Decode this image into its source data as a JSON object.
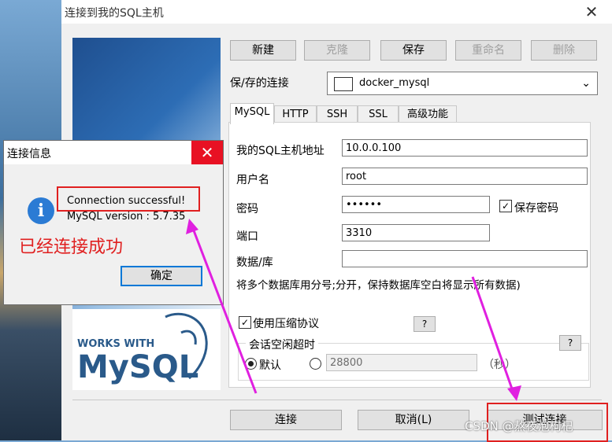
{
  "window": {
    "title": "连接到我的SQL主机",
    "close_label": "✕"
  },
  "toolbar": {
    "new": "新建",
    "clone": "克隆",
    "save": "保存",
    "rename": "重命名",
    "delete": "删除"
  },
  "saved_connection": {
    "label": "保/存的连接",
    "value": "docker_mysql"
  },
  "tabs": [
    "MySQL",
    "HTTP",
    "SSH",
    "SSL",
    "高级功能"
  ],
  "form": {
    "host_label": "我的SQL主机地址",
    "host_value": "10.0.0.100",
    "user_label": "用户名",
    "user_value": "root",
    "password_label": "密码",
    "password_value": "••••••",
    "save_password": "保存密码",
    "port_label": "端口",
    "port_value": "3310",
    "database_label": "数据/库",
    "database_value": "",
    "hint": "将多个数据库用分号;分开，保持数据库空白将显示所有数据)",
    "compression": "使用压缩协议",
    "help": "?",
    "idle_group": "会话空闲超时",
    "idle_default": "默认",
    "idle_value": "28800",
    "idle_unit": "（秒）"
  },
  "bottom": {
    "connect": "连接",
    "cancel": "取消(L)",
    "test": "测试连接"
  },
  "banner": {
    "works_with": "WORKS WITH",
    "mysql": "MySQL"
  },
  "dialog": {
    "title": "连接信息",
    "close_label": "✕",
    "line1": "Connection successful!",
    "line2": "MySQL version : 5.7.35",
    "ok": "确定",
    "icon_glyph": "i"
  },
  "annotation": "已经连接成功",
  "watermark": "CSDN @熬夜泡枸杞",
  "colors": {
    "annotation_red": "#e02020",
    "arrow_magenta": "#e020e0",
    "info_blue": "#2b7bd4"
  }
}
